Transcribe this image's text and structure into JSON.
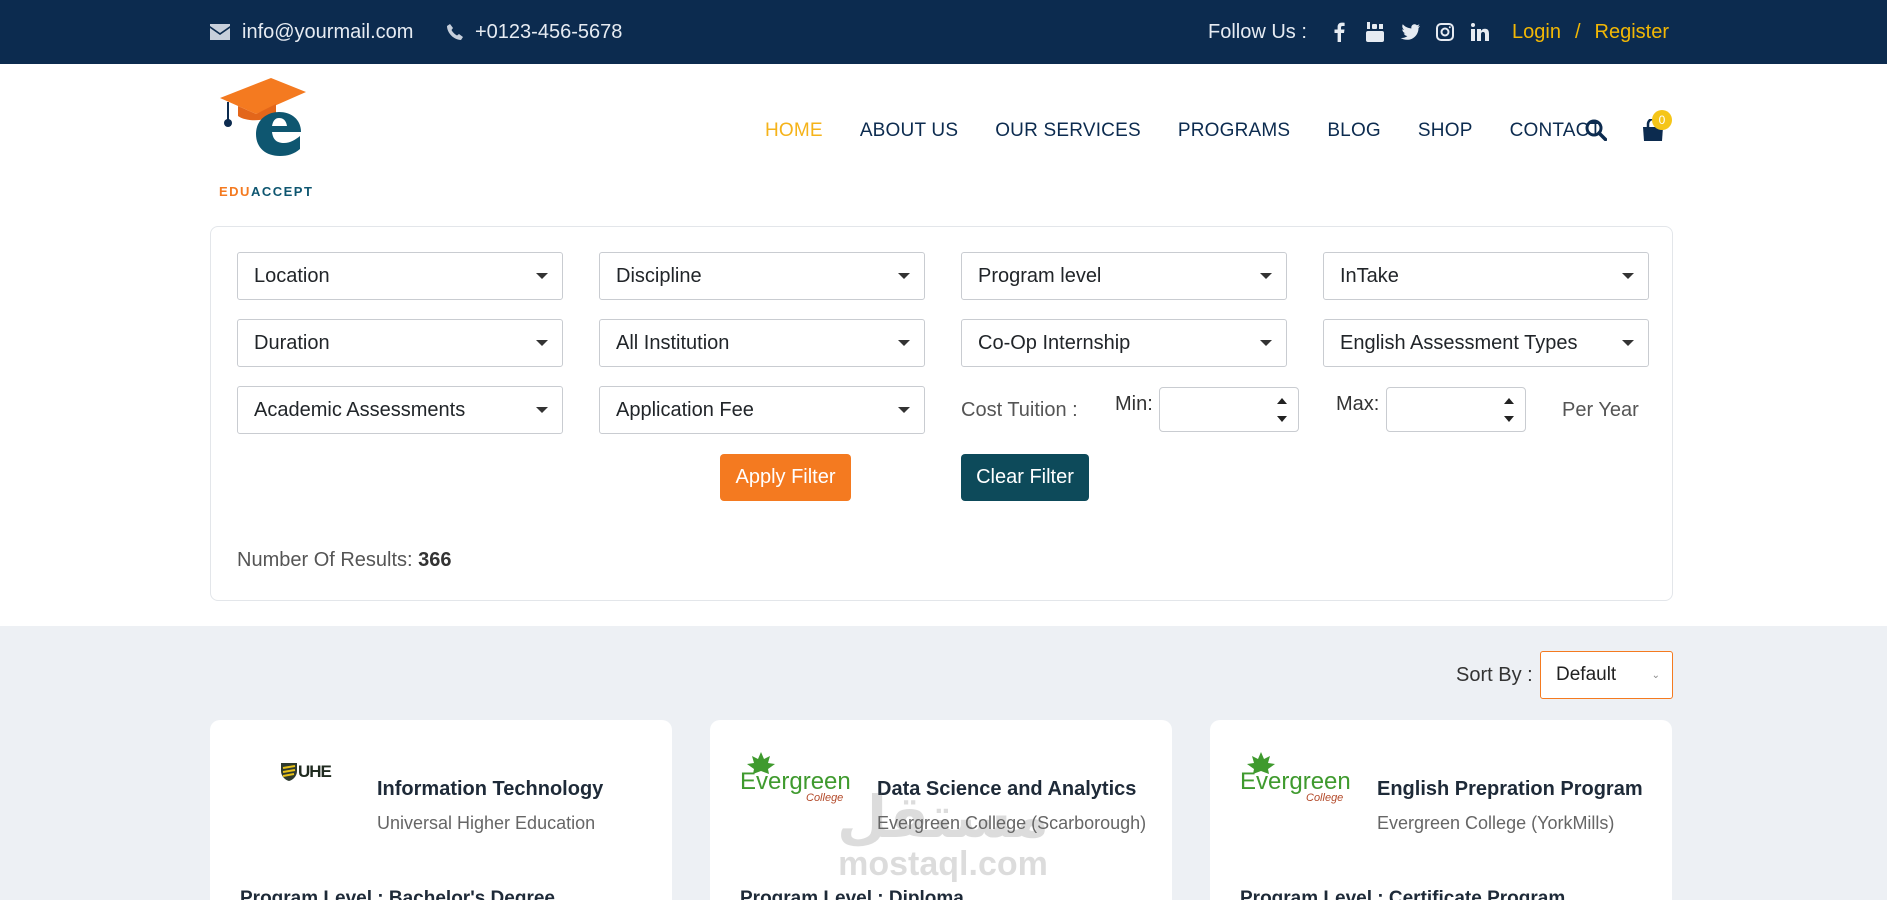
{
  "topbar": {
    "email": "info@yourmail.com",
    "phone": "+0123-456-5678",
    "follow_label": "Follow Us :",
    "social": [
      "facebook-icon",
      "youtube-icon",
      "twitter-icon",
      "instagram-icon",
      "linkedin-icon"
    ],
    "login": "Login",
    "separator": "/",
    "register": "Register"
  },
  "brand": {
    "name_part1": "EDU",
    "name_part2": "ACCEPT"
  },
  "nav": {
    "items": [
      "HOME",
      "ABOUT US",
      "OUR SERVICES",
      "PROGRAMS",
      "BLOG",
      "SHOP",
      "CONTACT"
    ],
    "active": "HOME",
    "cart_count": "0"
  },
  "filters": {
    "row1": [
      "Location",
      "Discipline",
      "Program level",
      "InTake"
    ],
    "row2": [
      "Duration",
      "All Institution",
      "Co-Op Internship",
      "English Assessment Types"
    ],
    "row3": [
      "Academic Assessments",
      "Application Fee"
    ],
    "cost_label": "Cost Tuition :",
    "min_label": "Min:",
    "max_label": "Max:",
    "per_year": "Per Year",
    "min_value": "",
    "max_value": "",
    "apply": "Apply Filter",
    "clear": "Clear Filter",
    "results_label": "Number Of Results:",
    "results_count": "366"
  },
  "sort": {
    "label": "Sort By :",
    "value": "Default"
  },
  "cards": [
    {
      "logo_text": "UHE",
      "title": "Information Technology",
      "institution": "Universal Higher Education",
      "level": "Program Level : Bachelor's Degree"
    },
    {
      "logo_text": "Evergreen",
      "logo_sub": "College",
      "title": "Data Science and Analytics",
      "institution": "Evergreen College (Scarborough)",
      "level": "Program Level : Diploma"
    },
    {
      "logo_text": "Evergreen",
      "logo_sub": "College",
      "title": "English Prepration Program",
      "institution": "Evergreen College (YorkMills)",
      "level": "Program Level : Certificate Program"
    }
  ],
  "watermark": {
    "arabic": "مستقل",
    "latin": "mostaql.com"
  },
  "colors": {
    "topbar": "#0c2b4f",
    "accent_orange": "#f47a20",
    "nav_active": "#f5b31a",
    "clear_button": "#0d4a5a",
    "auth_link": "#f2b705"
  }
}
